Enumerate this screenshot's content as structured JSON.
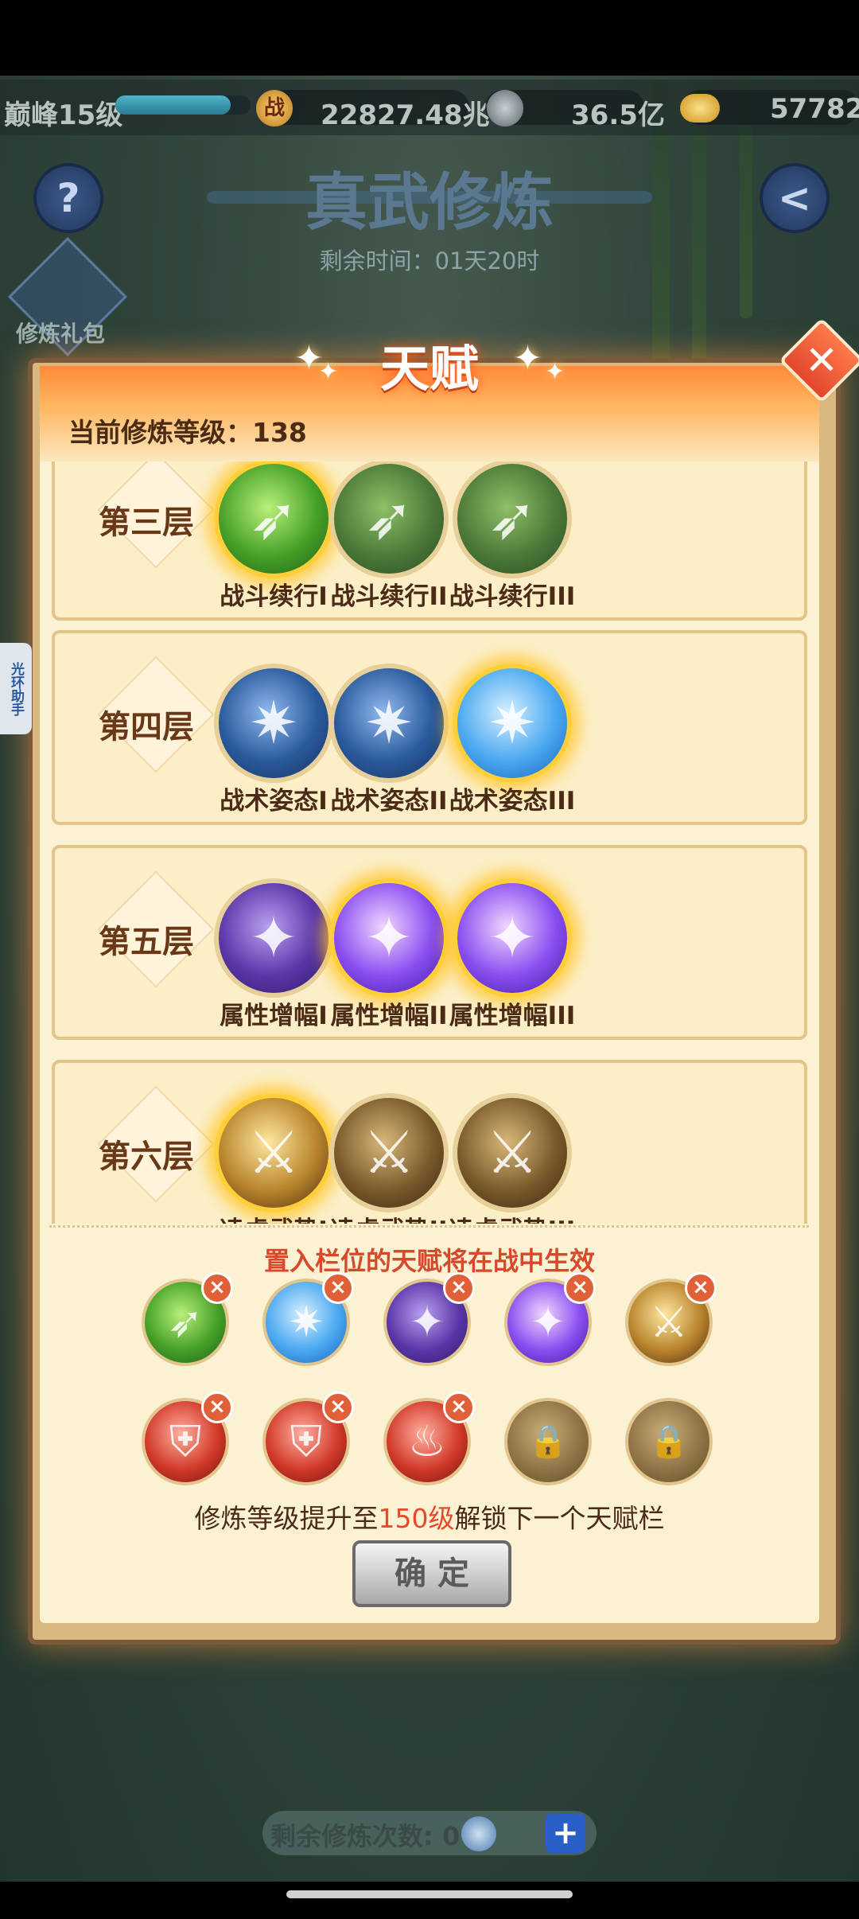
{
  "topbar": {
    "level": "巅峰15级",
    "level_progress": 0.85,
    "power_icon": "战",
    "power": "22827.48兆",
    "currency1": "36.5亿",
    "currency2": "57782"
  },
  "header": {
    "help": "?",
    "title": "真武修炼",
    "timer": "剩余时间：01天20时",
    "gift": "修炼礼包"
  },
  "panel": {
    "title": "天赋",
    "close": "✕",
    "current_level": "当前修炼等级：138",
    "tiers": [
      {
        "name": "第三层",
        "nodes": [
          {
            "label": "战斗续行I",
            "lit": true
          },
          {
            "label": "战斗续行II",
            "lit": false
          },
          {
            "label": "战斗续行III",
            "lit": false
          }
        ]
      },
      {
        "name": "第四层",
        "nodes": [
          {
            "label": "战术姿态I",
            "lit": false
          },
          {
            "label": "战术姿态II",
            "lit": false
          },
          {
            "label": "战术姿态III",
            "lit": true
          }
        ]
      },
      {
        "name": "第五层",
        "nodes": [
          {
            "label": "属性增幅I",
            "lit": false
          },
          {
            "label": "属性增幅II",
            "lit": true
          },
          {
            "label": "属性增幅III",
            "lit": true
          }
        ]
      },
      {
        "name": "第六层",
        "nodes": [
          {
            "label": "凌虚武势I",
            "lit": true
          },
          {
            "label": "凌虚武势II",
            "lit": false
          },
          {
            "label": "凌虚武势III",
            "lit": false
          }
        ]
      }
    ],
    "effect_note": "置入栏位的天赋将在战中生效",
    "unlock_note_a": "修炼等级提升至",
    "unlock_note_hl": "150级",
    "unlock_note_b": "解锁下一个天赋栏",
    "confirm": "确 定"
  },
  "side_tab": "光环助手",
  "footer": {
    "remaining_label": "剩余修炼次数:",
    "remaining_count": "0",
    "plus": "+"
  }
}
